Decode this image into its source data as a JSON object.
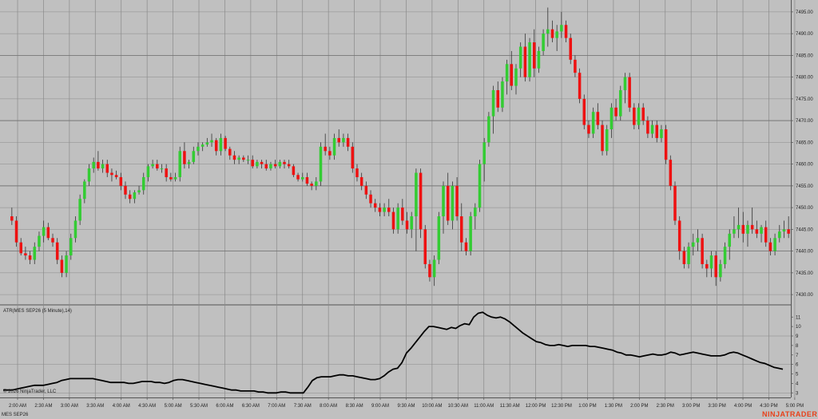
{
  "instrument_label": "MES SEP26",
  "indicator_label": "ATR(MES SEP26 (5 Minute),14)",
  "copyright": "© 2026 NinjaTrader, LLC",
  "brand": "NINJATRADER",
  "colors": {
    "background": "#c0c0c0",
    "grid": "#8a8a8a",
    "up": "#33cc33",
    "down": "#ee1111",
    "wick": "#333333",
    "atr_line": "#000000"
  },
  "chart_data": [
    {
      "type": "candlestick",
      "ylim": [
        7428,
        7497
      ],
      "y_ticks": [
        "7430.00",
        "7435.00",
        "7440.00",
        "7445.00",
        "7450.00",
        "7455.00",
        "7460.00",
        "7465.00",
        "7470.00",
        "7475.00",
        "7480.00",
        "7485.00",
        "7490.00",
        "7495.00"
      ],
      "x_ticks": [
        "2:00 AM",
        "2:30 AM",
        "3:00 AM",
        "3:30 AM",
        "4:00 AM",
        "4:30 AM",
        "5:00 AM",
        "5:30 AM",
        "6:00 AM",
        "6:30 AM",
        "7:00 AM",
        "7:30 AM",
        "8:00 AM",
        "8:30 AM",
        "9:00 AM",
        "9:30 AM",
        "10:00 AM",
        "10:30 AM",
        "11:00 AM",
        "11:30 AM",
        "12:00 PM",
        "12:30 PM",
        "1:00 PM",
        "1:30 PM",
        "2:00 PM",
        "2:30 PM",
        "3:00 PM",
        "3:30 PM",
        "4:00 PM",
        "4:30 PM",
        "5:00 PM"
      ],
      "grid": true,
      "candles": [
        [
          7448,
          7450,
          7446,
          7447
        ],
        [
          7447,
          7448,
          7441,
          7442
        ],
        [
          7442,
          7443,
          7439,
          7439.5
        ],
        [
          7439.5,
          7441,
          7438,
          7439
        ],
        [
          7439,
          7440,
          7437,
          7438
        ],
        [
          7438,
          7442,
          7437,
          7441
        ],
        [
          7441,
          7444.5,
          7440,
          7443.5
        ],
        [
          7443.5,
          7447,
          7442,
          7445.5
        ],
        [
          7445.5,
          7446.5,
          7442.5,
          7443
        ],
        [
          7443,
          7444,
          7441,
          7442
        ],
        [
          7442,
          7443,
          7437,
          7438
        ],
        [
          7438,
          7439,
          7434,
          7435
        ],
        [
          7435,
          7440,
          7434,
          7439
        ],
        [
          7439,
          7444,
          7438,
          7443
        ],
        [
          7443,
          7448,
          7442,
          7447
        ],
        [
          7447,
          7453,
          7446,
          7452
        ],
        [
          7452,
          7456.5,
          7451,
          7456
        ],
        [
          7456,
          7460,
          7455,
          7459
        ],
        [
          7459,
          7461.5,
          7458,
          7460.5
        ],
        [
          7460.5,
          7463,
          7458.5,
          7459
        ],
        [
          7459,
          7461,
          7458,
          7460
        ],
        [
          7460,
          7461,
          7457,
          7458
        ],
        [
          7458,
          7459,
          7456,
          7457.5
        ],
        [
          7457.5,
          7458.5,
          7456.5,
          7457
        ],
        [
          7457,
          7458,
          7454,
          7455
        ],
        [
          7455,
          7456,
          7452,
          7453
        ],
        [
          7453,
          7454,
          7451,
          7452
        ],
        [
          7452,
          7454,
          7451,
          7453.5
        ],
        [
          7453.5,
          7455,
          7453,
          7454
        ],
        [
          7454,
          7458,
          7453,
          7457
        ],
        [
          7457,
          7460,
          7456,
          7459.5
        ],
        [
          7459.5,
          7461,
          7459,
          7460
        ],
        [
          7460,
          7461,
          7458.5,
          7459
        ],
        [
          7459,
          7460,
          7458,
          7459
        ],
        [
          7459,
          7460,
          7456,
          7457
        ],
        [
          7457,
          7458,
          7456,
          7456.5
        ],
        [
          7456.5,
          7458,
          7456,
          7457
        ],
        [
          7457,
          7464,
          7456,
          7463
        ],
        [
          7463,
          7465,
          7459,
          7460
        ],
        [
          7460,
          7461,
          7459,
          7460.5
        ],
        [
          7460.5,
          7464,
          7460,
          7463
        ],
        [
          7463,
          7465,
          7462,
          7464
        ],
        [
          7464,
          7465,
          7463,
          7464.5
        ],
        [
          7464.5,
          7466,
          7464,
          7465
        ],
        [
          7465,
          7467,
          7464,
          7465.5
        ],
        [
          7465.5,
          7466,
          7462,
          7463
        ],
        [
          7463,
          7467,
          7462,
          7466
        ],
        [
          7466,
          7466.5,
          7463,
          7463.5
        ],
        [
          7463.5,
          7464,
          7461,
          7462
        ],
        [
          7462,
          7463,
          7460,
          7461
        ],
        [
          7461,
          7462,
          7460,
          7461.5
        ],
        [
          7461.5,
          7462,
          7460.5,
          7461
        ],
        [
          7461,
          7462,
          7460,
          7461
        ],
        [
          7461,
          7462,
          7459,
          7459.5
        ],
        [
          7459.5,
          7461,
          7459,
          7460.5
        ],
        [
          7460.5,
          7461,
          7459,
          7460
        ],
        [
          7460,
          7461,
          7458.5,
          7459
        ],
        [
          7459,
          7460.5,
          7458.5,
          7460
        ],
        [
          7460,
          7461,
          7459,
          7459.5
        ],
        [
          7459.5,
          7461,
          7459,
          7460.5
        ],
        [
          7460.5,
          7461,
          7459,
          7460
        ],
        [
          7460,
          7461,
          7459,
          7459.5
        ],
        [
          7459.5,
          7460,
          7457,
          7457.5
        ],
        [
          7457.5,
          7458,
          7456,
          7456.5
        ],
        [
          7456.5,
          7458,
          7456,
          7457
        ],
        [
          7457,
          7458,
          7455,
          7455.5
        ],
        [
          7455.5,
          7456,
          7454,
          7455
        ],
        [
          7455,
          7457,
          7454,
          7456
        ],
        [
          7456,
          7465,
          7455,
          7464
        ],
        [
          7464,
          7467,
          7462,
          7463
        ],
        [
          7463,
          7464,
          7461,
          7462
        ],
        [
          7462,
          7467,
          7461,
          7466
        ],
        [
          7466,
          7468,
          7464,
          7465
        ],
        [
          7465,
          7467,
          7464,
          7466
        ],
        [
          7466,
          7467,
          7463,
          7464
        ],
        [
          7464,
          7465,
          7458,
          7459
        ],
        [
          7459,
          7460,
          7456,
          7457
        ],
        [
          7457,
          7458,
          7454,
          7455
        ],
        [
          7455,
          7456,
          7452,
          7453
        ],
        [
          7453,
          7454,
          7450,
          7451
        ],
        [
          7451,
          7452,
          7449,
          7450
        ],
        [
          7450,
          7451,
          7448,
          7449
        ],
        [
          7449,
          7451,
          7448,
          7450
        ],
        [
          7450,
          7452,
          7448,
          7449
        ],
        [
          7449,
          7450,
          7444,
          7445
        ],
        [
          7445,
          7451,
          7444,
          7450
        ],
        [
          7450,
          7452,
          7446,
          7447
        ],
        [
          7447,
          7449,
          7444,
          7445
        ],
        [
          7445,
          7449,
          7443,
          7448
        ],
        [
          7448,
          7459,
          7440,
          7458
        ],
        [
          7458,
          7459,
          7443,
          7445
        ],
        [
          7445,
          7446,
          7436,
          7437
        ],
        [
          7437,
          7438,
          7433,
          7434
        ],
        [
          7434,
          7439,
          7432,
          7438
        ],
        [
          7438,
          7449,
          7437,
          7448
        ],
        [
          7448,
          7456,
          7444,
          7455
        ],
        [
          7455,
          7458,
          7446,
          7447
        ],
        [
          7447,
          7456,
          7445,
          7455
        ],
        [
          7455,
          7457,
          7447,
          7448
        ],
        [
          7448,
          7451,
          7440,
          7442
        ],
        [
          7442,
          7443,
          7439,
          7440
        ],
        [
          7440,
          7449,
          7439,
          7448
        ],
        [
          7448,
          7451,
          7445,
          7450
        ],
        [
          7450,
          7461,
          7449,
          7460
        ],
        [
          7460,
          7466,
          7456,
          7465
        ],
        [
          7465,
          7472,
          7464,
          7471
        ],
        [
          7471,
          7478,
          7467,
          7477
        ],
        [
          7477,
          7479,
          7472,
          7473
        ],
        [
          7473,
          7480,
          7472,
          7479
        ],
        [
          7479,
          7484,
          7476,
          7483
        ],
        [
          7483,
          7486,
          7477,
          7478
        ],
        [
          7478,
          7483,
          7476,
          7482
        ],
        [
          7482,
          7488,
          7480,
          7487
        ],
        [
          7487,
          7490,
          7479,
          7480
        ],
        [
          7480,
          7489,
          7479,
          7488
        ],
        [
          7488,
          7491,
          7480,
          7482
        ],
        [
          7482,
          7487,
          7481,
          7486
        ],
        [
          7486,
          7491,
          7485,
          7490
        ],
        [
          7490,
          7496,
          7487,
          7491
        ],
        [
          7491,
          7493,
          7488,
          7489
        ],
        [
          7489,
          7492,
          7486,
          7490.5
        ],
        [
          7490.5,
          7495,
          7489,
          7492
        ],
        [
          7492,
          7493,
          7488,
          7489
        ],
        [
          7489,
          7490,
          7483,
          7484
        ],
        [
          7484,
          7485,
          7480,
          7481
        ],
        [
          7481,
          7482,
          7474,
          7475
        ],
        [
          7475,
          7476,
          7468,
          7469
        ],
        [
          7469,
          7470,
          7466,
          7467
        ],
        [
          7467,
          7473,
          7466,
          7472
        ],
        [
          7472,
          7474,
          7468,
          7469
        ],
        [
          7469,
          7470,
          7462,
          7463
        ],
        [
          7463,
          7469,
          7462,
          7468
        ],
        [
          7468,
          7474,
          7466,
          7473
        ],
        [
          7473,
          7475,
          7470,
          7471
        ],
        [
          7471,
          7478,
          7470,
          7477
        ],
        [
          7477,
          7481,
          7474,
          7480
        ],
        [
          7480,
          7481,
          7472,
          7473
        ],
        [
          7473,
          7474,
          7468,
          7469
        ],
        [
          7469,
          7474,
          7468,
          7473
        ],
        [
          7473,
          7474,
          7469,
          7470
        ],
        [
          7470,
          7471,
          7466,
          7467
        ],
        [
          7467,
          7470,
          7466,
          7469
        ],
        [
          7469,
          7470,
          7465,
          7466
        ],
        [
          7466,
          7469,
          7465,
          7468
        ],
        [
          7468,
          7469,
          7460,
          7461
        ],
        [
          7461,
          7462,
          7454,
          7455
        ],
        [
          7455,
          7456,
          7446,
          7447
        ],
        [
          7447,
          7448,
          7438,
          7440
        ],
        [
          7440,
          7441,
          7436,
          7437
        ],
        [
          7437,
          7442,
          7436,
          7441
        ],
        [
          7441,
          7444,
          7439,
          7442
        ],
        [
          7442,
          7445,
          7440,
          7443
        ],
        [
          7443,
          7444,
          7436,
          7437
        ],
        [
          7437,
          7438,
          7434,
          7436
        ],
        [
          7436,
          7440,
          7434,
          7439
        ],
        [
          7439,
          7440,
          7432,
          7434
        ],
        [
          7434,
          7438,
          7433,
          7437
        ],
        [
          7437,
          7442,
          7436,
          7441
        ],
        [
          7441,
          7445,
          7438,
          7444
        ],
        [
          7444,
          7448,
          7443,
          7445
        ],
        [
          7445,
          7450,
          7443,
          7446
        ],
        [
          7446,
          7449,
          7442,
          7444
        ],
        [
          7444,
          7447,
          7441,
          7446
        ],
        [
          7446,
          7450,
          7444,
          7445
        ],
        [
          7445,
          7447,
          7443,
          7444
        ],
        [
          7444,
          7446,
          7442,
          7445.5
        ],
        [
          7445.5,
          7447,
          7441,
          7442
        ],
        [
          7442,
          7443,
          7439,
          7440
        ],
        [
          7440,
          7444,
          7439,
          7443
        ],
        [
          7443,
          7446,
          7442,
          7444.5
        ],
        [
          7444.5,
          7447,
          7443,
          7445
        ],
        [
          7445,
          7448,
          7443,
          7444
        ]
      ]
    },
    {
      "type": "line",
      "series_name": "ATR(MES SEP26 (5 Minute),14)",
      "ylim": [
        2.6,
        12.2
      ],
      "y_ticks": [
        "3",
        "4",
        "5",
        "6",
        "7",
        "8",
        "9",
        "10",
        "11"
      ],
      "values": [
        3.3,
        3.3,
        3.3,
        3.4,
        3.5,
        3.6,
        3.7,
        3.8,
        3.8,
        3.8,
        3.9,
        4.0,
        4.1,
        4.3,
        4.4,
        4.5,
        4.5,
        4.5,
        4.5,
        4.5,
        4.5,
        4.4,
        4.3,
        4.2,
        4.1,
        4.1,
        4.1,
        4.1,
        4.0,
        4.0,
        4.1,
        4.2,
        4.2,
        4.2,
        4.1,
        4.1,
        4.0,
        4.1,
        4.3,
        4.4,
        4.4,
        4.3,
        4.2,
        4.1,
        4.0,
        3.9,
        3.8,
        3.7,
        3.6,
        3.5,
        3.4,
        3.3,
        3.3,
        3.2,
        3.2,
        3.2,
        3.2,
        3.1,
        3.1,
        3.0,
        3.0,
        3.0,
        3.1,
        3.1,
        3.0,
        3.0,
        3.0,
        3.0,
        3.6,
        4.3,
        4.6,
        4.7,
        4.7,
        4.7,
        4.8,
        4.9,
        4.9,
        4.8,
        4.8,
        4.7,
        4.6,
        4.5,
        4.4,
        4.4,
        4.5,
        4.8,
        5.2,
        5.5,
        5.6,
        6.2,
        7.2,
        7.7,
        8.3,
        8.9,
        9.5,
        10.0,
        10.0,
        9.9,
        9.8,
        9.7,
        9.9,
        9.8,
        10.1,
        10.3,
        10.2,
        11.0,
        11.4,
        11.5,
        11.2,
        11.0,
        10.9,
        11.0,
        10.8,
        10.5,
        10.1,
        9.7,
        9.3,
        9.0,
        8.7,
        8.4,
        8.3,
        8.1,
        8.0,
        8.0,
        8.1,
        8.0,
        7.9,
        8.0,
        8.0,
        8.0,
        8.0,
        7.9,
        7.9,
        7.8,
        7.7,
        7.6,
        7.5,
        7.3,
        7.2,
        7.0,
        7.0,
        6.9,
        6.8,
        6.9,
        7.0,
        7.1,
        7.0,
        7.0,
        7.1,
        7.3,
        7.2,
        7.0,
        7.1,
        7.2,
        7.3,
        7.2,
        7.1,
        7.0,
        6.9,
        6.9,
        6.9,
        7.0,
        7.2,
        7.3,
        7.2,
        7.0,
        6.8,
        6.6,
        6.4,
        6.2,
        6.1,
        5.9,
        5.7,
        5.6,
        5.5
      ]
    }
  ]
}
